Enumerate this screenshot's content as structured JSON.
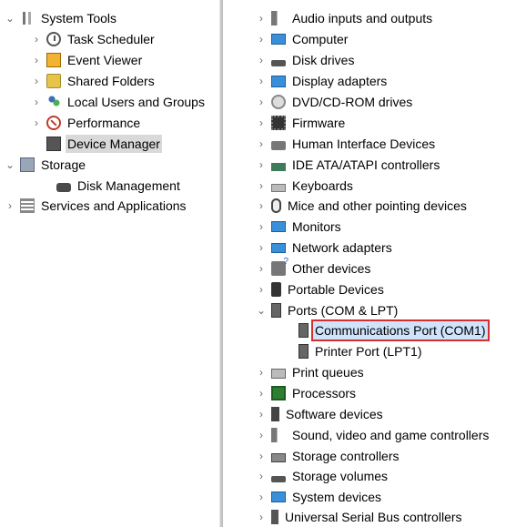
{
  "left_tree": {
    "system_tools": "System Tools",
    "task_scheduler": "Task Scheduler",
    "event_viewer": "Event Viewer",
    "shared_folders": "Shared Folders",
    "local_users_groups": "Local Users and Groups",
    "performance": "Performance",
    "device_manager": "Device Manager",
    "storage": "Storage",
    "disk_management": "Disk Management",
    "services_apps": "Services and Applications"
  },
  "devices": {
    "audio": "Audio inputs and outputs",
    "computer": "Computer",
    "disk_drives": "Disk drives",
    "display": "Display adapters",
    "dvd": "DVD/CD-ROM drives",
    "firmware": "Firmware",
    "hid": "Human Interface Devices",
    "ide": "IDE ATA/ATAPI controllers",
    "keyboards": "Keyboards",
    "mice": "Mice and other pointing devices",
    "monitors": "Monitors",
    "network": "Network adapters",
    "other": "Other devices",
    "portable": "Portable Devices",
    "ports": "Ports (COM & LPT)",
    "com1": "Communications Port (COM1)",
    "lpt1": "Printer Port (LPT1)",
    "print_queues": "Print queues",
    "processors": "Processors",
    "software": "Software devices",
    "sound": "Sound, video and game controllers",
    "storage_ctl": "Storage controllers",
    "storage_vol": "Storage volumes",
    "system": "System devices",
    "usb": "Universal Serial Bus controllers"
  },
  "glyphs": {
    "collapsed": "›",
    "expanded": "⌄"
  },
  "colors": {
    "highlight_border": "#d32f2f",
    "highlight_fill": "#cfe3fb",
    "selected_fill": "#d9d9d9"
  }
}
